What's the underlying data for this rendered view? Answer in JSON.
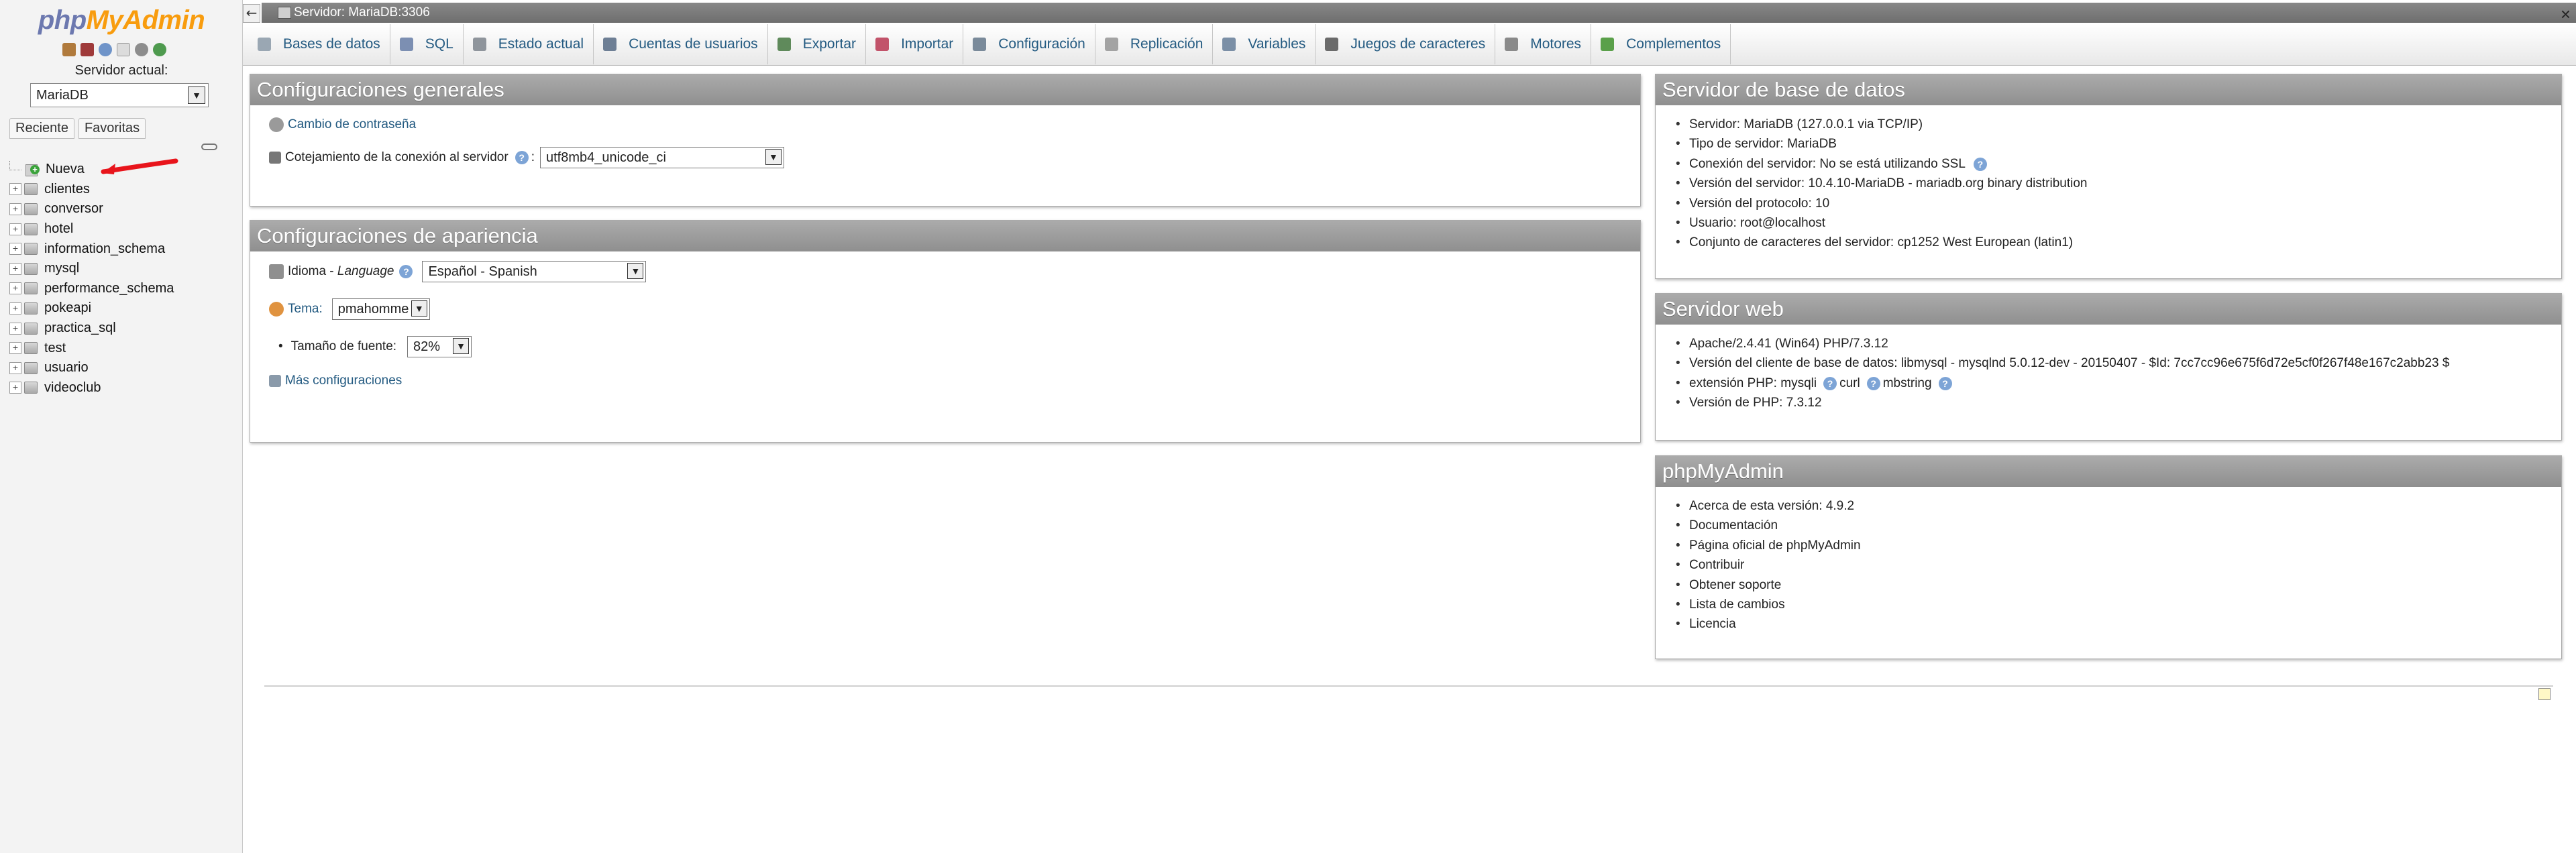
{
  "nav": {
    "logo_php": "php",
    "logo_myadmin": "MyAdmin",
    "server_label": "Servidor actual:",
    "server_value": "MariaDB",
    "tabs": [
      "Reciente",
      "Favoritas"
    ],
    "new_label": "Nueva",
    "databases": [
      "clientes",
      "conversor",
      "hotel",
      "information_schema",
      "mysql",
      "performance_schema",
      "pokeapi",
      "practica_sql",
      "test",
      "usuario",
      "videoclub"
    ]
  },
  "topbar": {
    "server": "Servidor: MariaDB:3306",
    "collapse": "←",
    "close": "×"
  },
  "menu": [
    {
      "label": "Bases de datos",
      "color": "#9aa7b3"
    },
    {
      "label": "SQL",
      "color": "#7c8fb2"
    },
    {
      "label": "Estado actual",
      "color": "#8f959c"
    },
    {
      "label": "Cuentas de usuarios",
      "color": "#6e7f95"
    },
    {
      "label": "Exportar",
      "color": "#5f8a5b"
    },
    {
      "label": "Importar",
      "color": "#c2536a"
    },
    {
      "label": "Configuración",
      "color": "#7a8a9a"
    },
    {
      "label": "Replicación",
      "color": "#a3a3a3"
    },
    {
      "label": "Variables",
      "color": "#7b8fa6"
    },
    {
      "label": "Juegos de caracteres",
      "color": "#6b6b6b"
    },
    {
      "label": "Motores",
      "color": "#8a8a8a"
    },
    {
      "label": "Complementos",
      "color": "#5aa04a"
    }
  ],
  "general": {
    "title": "Configuraciones generales",
    "change_password": "Cambio de contraseña",
    "collation_label": "Cotejamiento de la conexión al servidor",
    "collation_colon": ":",
    "collation_value": "utf8mb4_unicode_ci"
  },
  "appearance": {
    "title": "Configuraciones de apariencia",
    "language_label": "Idioma - ",
    "language_label_italic": "Language",
    "language_value": "Español - Spanish",
    "theme_label": "Tema:",
    "theme_value": "pmahomme",
    "fontsize_label": "Tamaño de fuente:",
    "fontsize_value": "82%",
    "more_settings": "Más configuraciones"
  },
  "db_server": {
    "title": "Servidor de base de datos",
    "items": [
      "Servidor: MariaDB (127.0.0.1 via TCP/IP)",
      "Tipo de servidor: MariaDB",
      "Conexión del servidor: No se está utilizando SSL",
      "Versión del servidor: 10.4.10-MariaDB - mariadb.org binary distribution",
      "Versión del protocolo: 10",
      "Usuario: root@localhost",
      "Conjunto de caracteres del servidor: cp1252 West European (latin1)"
    ]
  },
  "web_server": {
    "title": "Servidor web",
    "items": [
      "Apache/2.4.41 (Win64) PHP/7.3.12",
      "Versión del cliente de base de datos: libmysql - mysqlnd 5.0.12-dev - 20150407 - $Id: 7cc7cc96e675f6d72e5cf0f267f48e167c2abb23 $",
      "extensión PHP: mysqli",
      "Versión de PHP: 7.3.12"
    ],
    "ext_curl": "curl",
    "ext_mbstring": "mbstring"
  },
  "pma": {
    "title": "phpMyAdmin",
    "version": "Acerca de esta versión: 4.9.2",
    "links": [
      "Documentación",
      "Página oficial de phpMyAdmin",
      "Contribuir",
      "Obtener soporte",
      "Lista de cambios",
      "Licencia"
    ]
  },
  "colors": {
    "link": "#235a81",
    "panel_header": "#9a9a9a",
    "logo_orange": "#f89c0e",
    "logo_blue": "#6c78af",
    "annotation": "#e8141b"
  }
}
